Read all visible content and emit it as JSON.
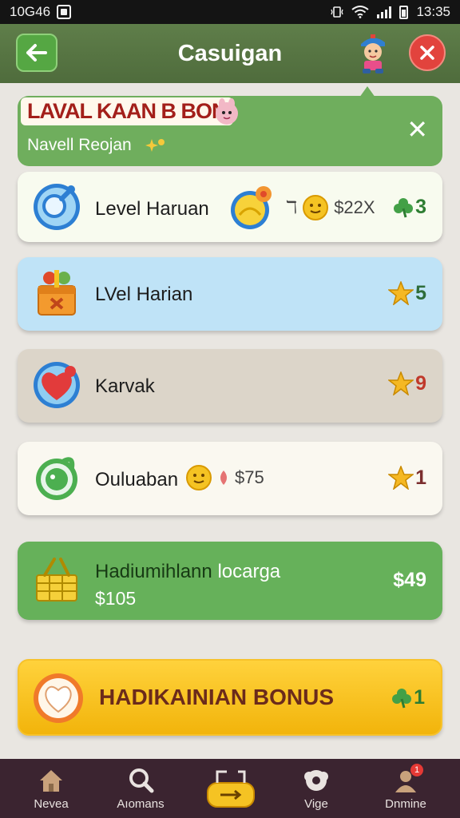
{
  "status_bar": {
    "time_left": "10G46",
    "time_right": "13:35"
  },
  "header": {
    "title": "Casuigan",
    "back_icon": "back-arrow-icon",
    "close_icon": "close-icon"
  },
  "banner": {
    "title": "LAVAL KAAN B BON",
    "subtitle": "Navell Reojan",
    "close_glyph": "✕"
  },
  "cards": [
    {
      "label": "Level Haruan",
      "extra_prefix": "ℸ",
      "extra_value": "$22X",
      "reward": "3",
      "icon": "magnifier-icon",
      "reward_icon": "clover-icon"
    },
    {
      "label": "LVel Harian",
      "reward": "5",
      "icon": "gift-box-icon",
      "reward_icon": "star-icon"
    },
    {
      "label": "Karvak",
      "reward": "9",
      "icon": "heart-icon",
      "reward_icon": "star-icon"
    },
    {
      "label": "Ouluaban",
      "extra_value": "$75",
      "reward": "1",
      "icon": "green-blob-icon",
      "reward_icon": "star-icon"
    },
    {
      "label": "Hadiumihlann",
      "label_extra": "locarga",
      "amount": "$105",
      "reward": "$49",
      "icon": "basket-icon"
    }
  ],
  "bonus": {
    "label": "HADIKAINIAN BONUS",
    "reward": "1",
    "icon": "heart-badge-icon",
    "reward_icon": "clover-icon"
  },
  "nav": [
    {
      "label": "Nevea",
      "icon": "home-icon"
    },
    {
      "label": "Aıomans",
      "icon": "search-icon"
    },
    {
      "label": "",
      "icon": "ticket-icon"
    },
    {
      "label": "Vige",
      "icon": "gamepad-icon"
    },
    {
      "label": "Dnmine",
      "icon": "profile-icon",
      "badge": "1"
    }
  ],
  "colors": {
    "header": "#5a7845",
    "accent_green": "#66b15a",
    "bonus_yellow": "#f7c22a",
    "nav_bg": "#3b2430"
  }
}
